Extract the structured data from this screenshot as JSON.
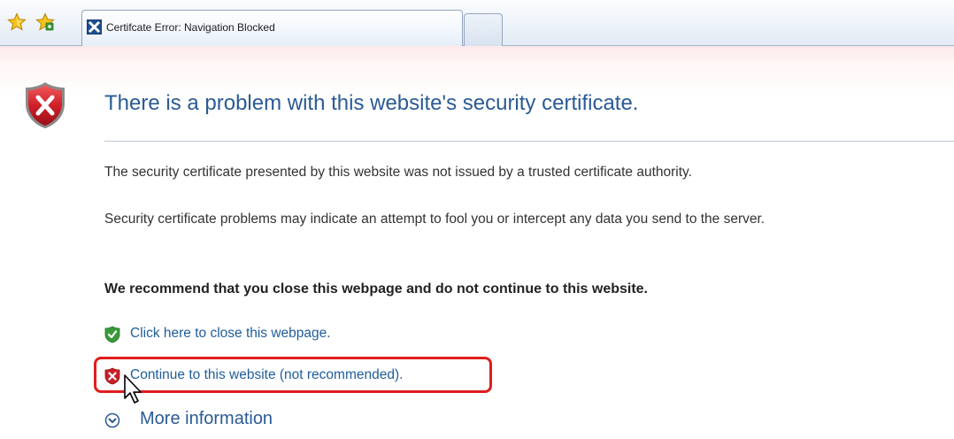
{
  "browser": {
    "tabs": [
      {
        "title": "Certifcate Error: Navigation Blocked",
        "active": true,
        "icon": "certificate-error-icon"
      },
      {
        "title": "",
        "active": false,
        "icon": "new-tab"
      }
    ],
    "toolbar_icons": [
      "favorites-star-icon",
      "add-favorite-star-icon"
    ]
  },
  "page": {
    "title": "There is a problem with this website's security certificate.",
    "paragraphs": [
      "The security certificate presented by this website was not issued by a trusted certificate authority.",
      "Security certificate problems may indicate an attempt to fool you or intercept any data you send to the server."
    ],
    "recommendation": "We recommend that you close this webpage and do not continue to this website.",
    "links": {
      "close": {
        "label": "Click here to close this webpage.",
        "icon": "green-shield-check-icon"
      },
      "continue": {
        "label": "Continue to this website (not recommended).",
        "icon": "red-shield-x-icon"
      },
      "more_info": {
        "label": "More information",
        "icon": "expand-circle-icon"
      }
    }
  },
  "colors": {
    "title_blue": "#2a5a96",
    "link_blue": "#1f5d9c",
    "highlight_red": "#e01d1d",
    "shield_red": "#c8202a",
    "shield_green": "#3a9a3a"
  }
}
